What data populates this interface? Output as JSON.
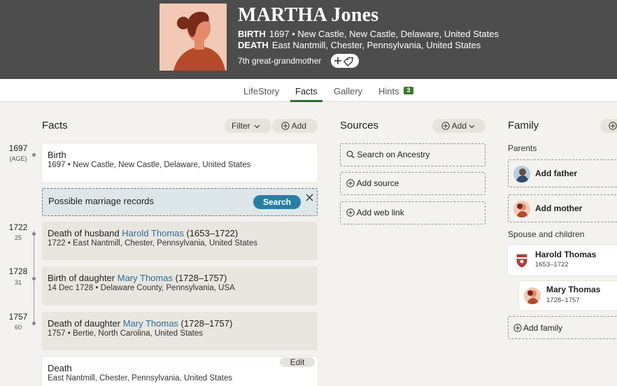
{
  "person": {
    "name": "MARTHA Jones",
    "birth_label": "BIRTH",
    "birth_value": "1697 • New Castle, New Castle, Delaware, United States",
    "death_label": "DEATH",
    "death_value": "East Nantmill, Chester, Pennsylvania, United States",
    "relationship": "7th great-grandmother"
  },
  "tabs": [
    {
      "label": "LifeStory"
    },
    {
      "label": "Facts"
    },
    {
      "label": "Gallery"
    },
    {
      "label": "Hints"
    }
  ],
  "hints_count": "3",
  "facts": {
    "title": "Facts",
    "filter_label": "Filter",
    "add_label": "Add",
    "birth_title": "Birth",
    "birth_detail": "1697 • New Castle, New Castle, Delaware, United States",
    "birth_year": "1697",
    "birth_age": "(AGE)",
    "suggestion_text": "Possible marriage records",
    "suggestion_button": "Search",
    "events": [
      {
        "year": "1722",
        "age": "25",
        "prefix": "Death of husband ",
        "person": "Harold Thomas",
        "dates": " (1653–1722)",
        "detail": "1722 • East Nantmill, Chester, Pennsylvania, United States"
      },
      {
        "year": "1728",
        "age": "31",
        "prefix": "Birth of daughter ",
        "person": "Mary Thomas",
        "dates": " (1728–1757)",
        "detail": "14 Dec 1728 • Delaware County, Pennsylvania, USA"
      },
      {
        "year": "1757",
        "age": "60",
        "prefix": "Death of daughter ",
        "person": "Mary Thomas",
        "dates": " (1728–1757)",
        "detail": "1757 • Bertie, North Carolina, United States"
      }
    ],
    "death_title": "Death",
    "death_detail": "East Nantmill, Chester, Pennsylvania, United States",
    "edit_label": "Edit"
  },
  "sources": {
    "title": "Sources",
    "add_label": "Add",
    "search_label": "Search on Ancestry",
    "add_source_label": "Add source",
    "add_web_link_label": "Add web link"
  },
  "family": {
    "title": "Family",
    "parents_label": "Parents",
    "add_father": "Add father",
    "add_mother": "Add mother",
    "spouse_label": "Spouse and children",
    "spouse_name": "Harold Thomas",
    "spouse_dates": "1653–1722",
    "child_name": "Mary Thomas",
    "child_dates": "1728–1757",
    "add_family": "Add family"
  },
  "colors": {
    "header_bg": "#4d4d4d",
    "accent_green": "#2f6b2f",
    "link_blue": "#2e6d99",
    "search_button": "#2a7ea3"
  }
}
